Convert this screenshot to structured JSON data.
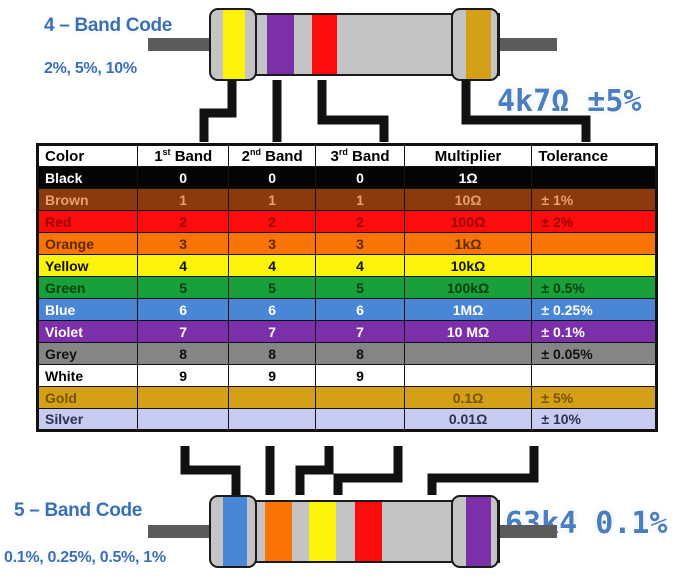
{
  "top_section": {
    "title": "4 – Band Code",
    "tolerances": "2%, 5%, 10%",
    "value": "4k7Ω  ±5%",
    "bands": [
      "Yellow",
      "Violet",
      "Red",
      "Gold"
    ]
  },
  "bottom_section": {
    "title": "5 – Band Code",
    "tolerances": "0.1%, 0.25%, 0.5%, 1%",
    "value": "63k4 0.1%",
    "bands": [
      "Blue",
      "Orange",
      "Yellow",
      "Red",
      "Violet"
    ]
  },
  "table": {
    "headers": {
      "color": "Color",
      "band1_sup": "st",
      "band1": "1",
      "band1_word": " Band",
      "band2_sup": "nd",
      "band2": "2",
      "band2_word": " Band",
      "band3_sup": "rd",
      "band3": "3",
      "band3_word": " Band",
      "multiplier": "Multiplier",
      "tolerance": "Tolerance"
    },
    "rows": [
      {
        "color": "Black",
        "b1": "0",
        "b2": "0",
        "b3": "0",
        "mult": "1Ω",
        "tol": "",
        "bg": "#050505",
        "fg": "#ffffff"
      },
      {
        "color": "Brown",
        "b1": "1",
        "b2": "1",
        "b3": "1",
        "mult": "10Ω",
        "tol": "± 1%",
        "bg": "#8a3a0c",
        "fg": "#e8a070"
      },
      {
        "color": "Red",
        "b1": "2",
        "b2": "2",
        "b3": "2",
        "mult": "100Ω",
        "tol": "± 2%",
        "bg": "#fc0d0d",
        "fg": "#9c0000"
      },
      {
        "color": "Orange",
        "b1": "3",
        "b2": "3",
        "b3": "3",
        "mult": "1kΩ",
        "tol": "",
        "bg": "#f97306",
        "fg": "#5c2a00"
      },
      {
        "color": "Yellow",
        "b1": "4",
        "b2": "4",
        "b3": "4",
        "mult": "10kΩ",
        "tol": "",
        "bg": "#fbf40a",
        "fg": "#111111"
      },
      {
        "color": "Green",
        "b1": "5",
        "b2": "5",
        "b3": "5",
        "mult": "100kΩ",
        "tol": "± 0.5%",
        "bg": "#19a03a",
        "fg": "#05400f"
      },
      {
        "color": "Blue",
        "b1": "6",
        "b2": "6",
        "b3": "6",
        "mult": "1MΩ",
        "tol": "± 0.25%",
        "bg": "#4a86d6",
        "fg": "#ffffff"
      },
      {
        "color": "Violet",
        "b1": "7",
        "b2": "7",
        "b3": "7",
        "mult": "10 MΩ",
        "tol": "± 0.1%",
        "bg": "#7b2fa8",
        "fg": "#ffffff"
      },
      {
        "color": "Grey",
        "b1": "8",
        "b2": "8",
        "b3": "8",
        "mult": "",
        "tol": "± 0.05%",
        "bg": "#858585",
        "fg": "#111111"
      },
      {
        "color": "White",
        "b1": "9",
        "b2": "9",
        "b3": "9",
        "mult": "",
        "tol": "",
        "bg": "#ffffff",
        "fg": "#000000"
      },
      {
        "color": "Gold",
        "b1": "",
        "b2": "",
        "b3": "",
        "mult": "0.1Ω",
        "tol": "± 5%",
        "bg": "#d4a017",
        "fg": "#7a5200"
      },
      {
        "color": "Silver",
        "b1": "",
        "b2": "",
        "b3": "",
        "mult": "0.01Ω",
        "tol": "± 10%",
        "bg": "#c8cbf0",
        "fg": "#2d3050"
      }
    ]
  },
  "palette": {
    "accent_blue": "#3a6fb5",
    "value_blue": "#4a7ec0",
    "lead_grey": "#5b5b5b",
    "body_grey": "#c4c4c4",
    "outline": "#1a1a1a"
  }
}
